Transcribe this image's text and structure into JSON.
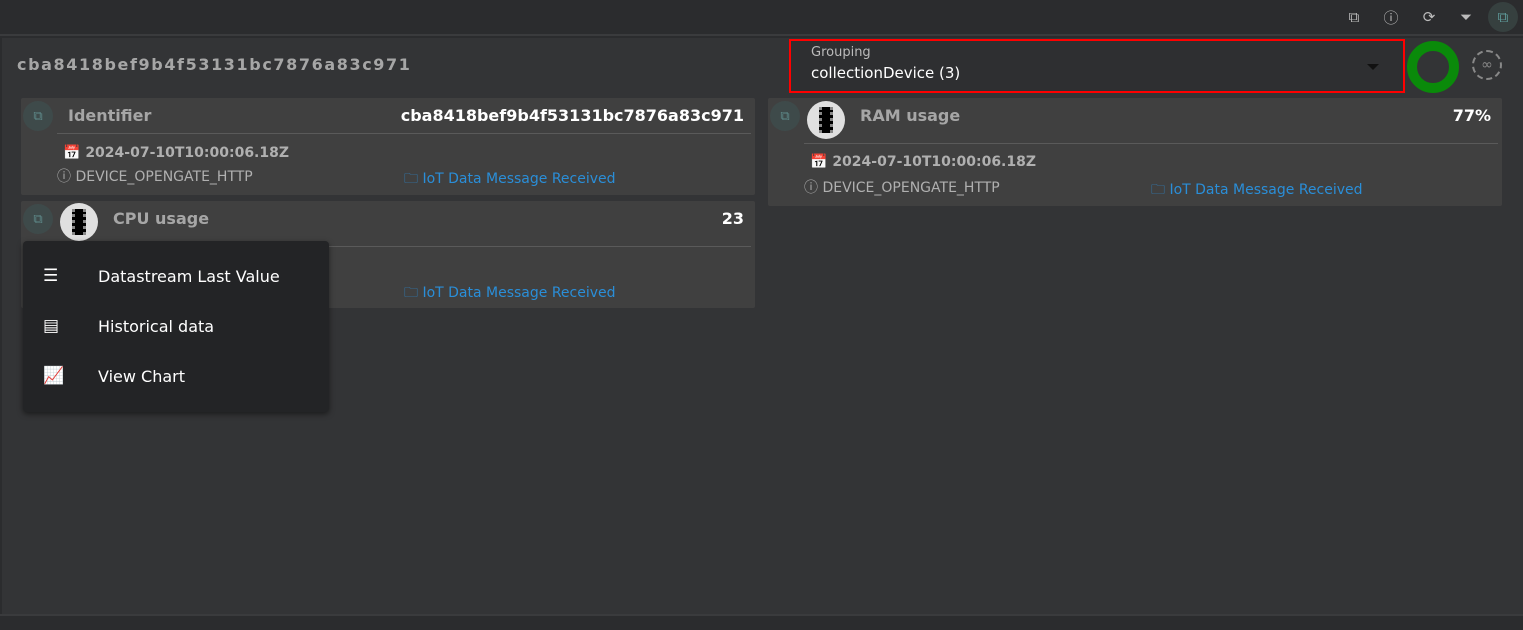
{
  "toolbar": {
    "icons": [
      "export-icon",
      "info-icon",
      "refresh-icon",
      "filter-icon",
      "select-icon"
    ]
  },
  "page": {
    "title": "cba8418bef9b4f53131bc7876a83c971"
  },
  "grouping": {
    "label": "Grouping",
    "value": "collectionDevice (3)"
  },
  "status": {
    "color": "#0a8a0a"
  },
  "cards": [
    {
      "name": "Identifier",
      "value": "cba8418bef9b4f53131bc7876a83c971",
      "date": "2024-07-10T10:00:06.18Z",
      "source": "DEVICE_OPENGATE_HTTP",
      "event": "IoT Data Message Received"
    },
    {
      "name": "CPU usage",
      "value": "23",
      "event": "IoT Data Message Received"
    },
    {
      "name": "RAM usage",
      "value": "77%",
      "date": "2024-07-10T10:00:06.18Z",
      "source": "DEVICE_OPENGATE_HTTP",
      "event": "IoT Data Message Received"
    }
  ],
  "menu": {
    "items": [
      {
        "label": "Datastream Last Value"
      },
      {
        "label": "Historical data"
      },
      {
        "label": "View Chart"
      }
    ]
  }
}
